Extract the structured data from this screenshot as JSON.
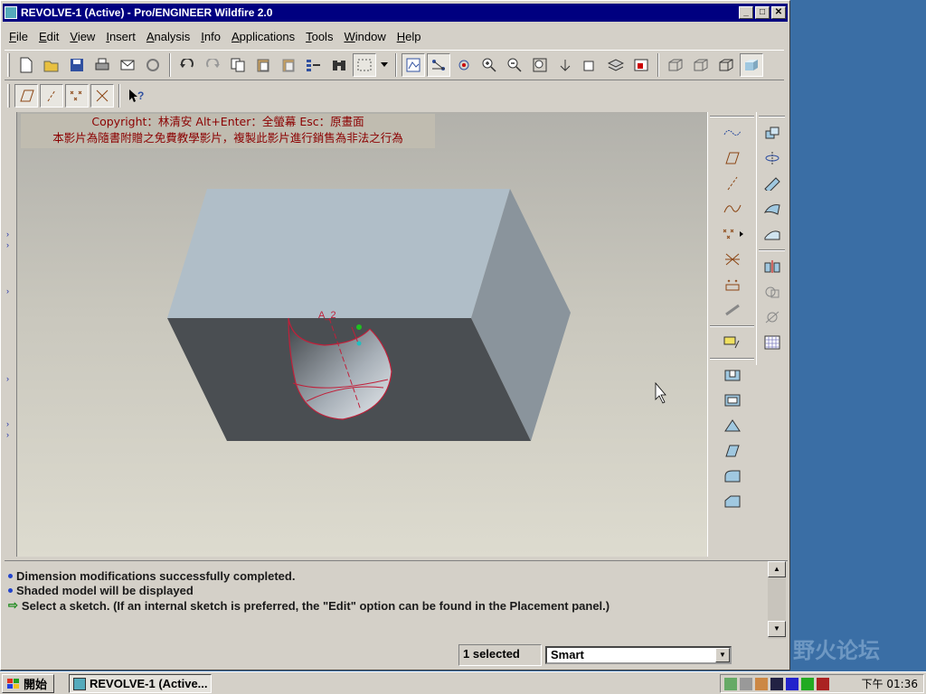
{
  "window": {
    "title": "REVOLVE-1 (Active) - Pro/ENGINEER Wildfire 2.0",
    "min": "_",
    "max": "□",
    "close": "✕"
  },
  "menu": [
    "File",
    "Edit",
    "View",
    "Insert",
    "Analysis",
    "Info",
    "Applications",
    "Tools",
    "Window",
    "Help"
  ],
  "toolbar1": {
    "icons": [
      "new-icon",
      "open-icon",
      "save-icon",
      "print-icon",
      "send-icon",
      "regenerate-icon",
      "undo-icon",
      "redo-icon",
      "copy-icon",
      "paste-icon",
      "paste-special-icon",
      "relations-icon",
      "find-icon",
      "select-box-icon",
      "dropdown-arrow-icon",
      "sketch-icon",
      "datum-icon",
      "spin-icon",
      "zoom-in-icon",
      "zoom-out-icon",
      "refit-icon",
      "orient-icon",
      "saved-views-icon",
      "layers-icon",
      "view-manager-icon",
      "wireframe-icon",
      "hidden-line-icon",
      "no-hidden-icon",
      "shading-icon"
    ]
  },
  "toolbar2": {
    "icons": [
      "plane-display-icon",
      "axis-display-icon",
      "point-display-icon",
      "csys-display-icon",
      "context-help-icon"
    ]
  },
  "viewport": {
    "copyright_line1": "Copyright：林清安     Alt+Enter：全螢幕     Esc：原畫面",
    "copyright_line2": "本影片為隨書附贈之免費教學影片，複製此影片進行銷售為非法之行為",
    "dimension_label": "A_2"
  },
  "right_toolbar_1": [
    "datum-curve-sketch-icon",
    "datum-plane-icon",
    "datum-axis-icon",
    "datum-curve-icon",
    "datum-point-icon",
    "datum-csys-icon",
    "analysis-feature-icon",
    "insert-shared-data-icon",
    "insert-annotation-icon",
    "hole-icon",
    "shell-icon",
    "rib-icon",
    "draft-icon",
    "round-icon",
    "chamfer-icon"
  ],
  "right_toolbar_2": [
    "extrude-icon",
    "revolve-icon",
    "variable-section-sweep-icon",
    "boundary-blend-icon",
    "style-icon",
    "mirror-icon",
    "merge-icon",
    "trim-icon",
    "pattern-icon"
  ],
  "messages": [
    {
      "type": "info",
      "text": "Dimension modifications successfully completed."
    },
    {
      "type": "info",
      "text": "Shaded model will be displayed"
    },
    {
      "type": "prompt",
      "text": "Select a sketch. (If an internal sketch is preferred, the \"Edit\" option can be found in the Placement panel.)"
    }
  ],
  "status": {
    "selected": "1 selected",
    "filter": "Smart"
  },
  "taskbar": {
    "start": "開始",
    "task": "REVOLVE-1 (Active...",
    "clock": "下午 01:36"
  },
  "watermark": "野火论坛"
}
